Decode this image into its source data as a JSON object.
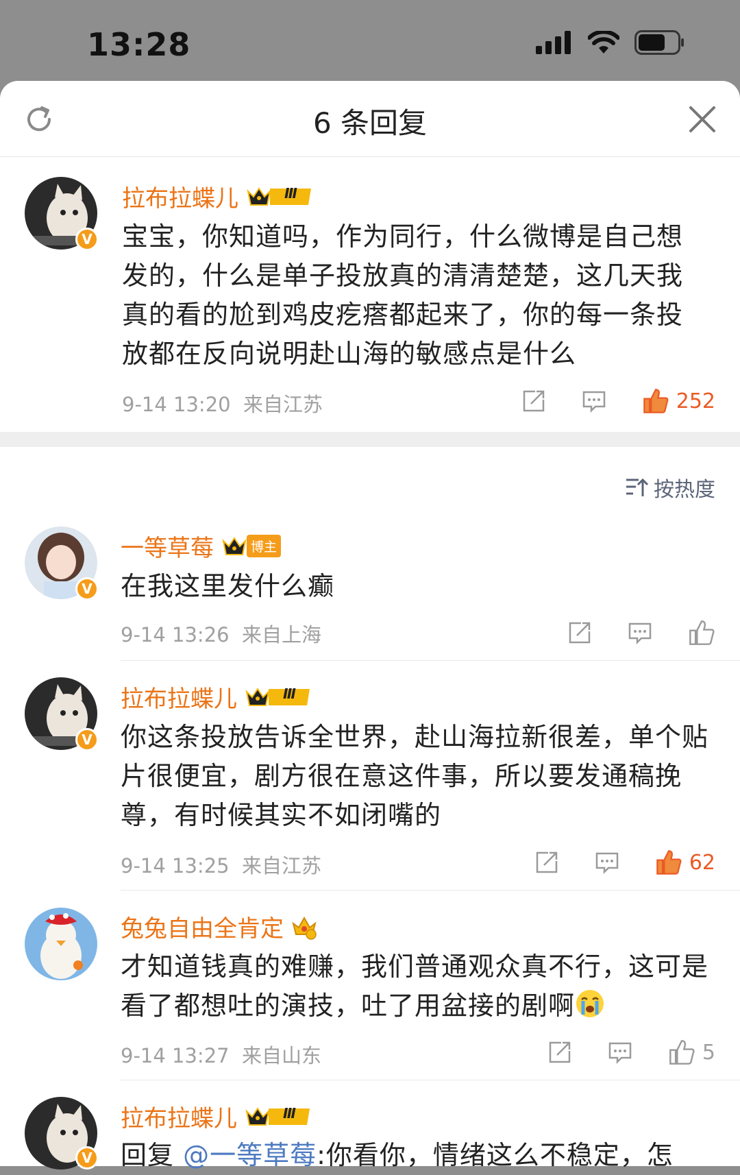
{
  "status_bar": {
    "time": "13:28"
  },
  "header": {
    "title": "6 条回复"
  },
  "sort_label": "按热度",
  "colors": {
    "name": "#eb7417",
    "like_active": "#eb5a25",
    "icon_gray": "#9a9a9a",
    "vip_gold": "#f5b90e"
  },
  "main_comment": {
    "user": "拉布拉蝶儿",
    "vip_level": "Ⅲ",
    "text": "宝宝，你知道吗，作为同行，什么微博是自己想发的，什么是单子投放真的清清楚楚，这几天我真的看的尬到鸡皮疙瘩都起来了，你的每一条投放都在反向说明赴山海的敏感点是什么",
    "time": "9-14 13:20",
    "location": "来自江苏",
    "likes": "252"
  },
  "replies": [
    {
      "user": "一等草莓",
      "badge": "博主",
      "text": "在我这里发什么癫",
      "time": "9-14 13:26",
      "location": "来自上海",
      "likes": ""
    },
    {
      "user": "拉布拉蝶儿",
      "vip_level": "Ⅲ",
      "text": "你这条投放告诉全世界，赴山海拉新很差，单个贴片很便宜，剧方很在意这件事，所以要发通稿挽尊，有时候其实不如闭嘴的",
      "time": "9-14 13:25",
      "location": "来自江苏",
      "likes": "62"
    },
    {
      "user": "兔兔自由全肯定",
      "text": "才知道钱真的难赚，我们普通观众真不行，这可是看了都想吐的演技，吐了用盆接的剧啊",
      "time": "9-14 13:27",
      "location": "来自山东",
      "likes": "5"
    },
    {
      "user": "拉布拉蝶儿",
      "vip_level": "Ⅲ",
      "reply_prefix": "回复",
      "mention": "@一等草莓",
      "text": ":你看你，情绪这么不稳定，怎"
    }
  ]
}
